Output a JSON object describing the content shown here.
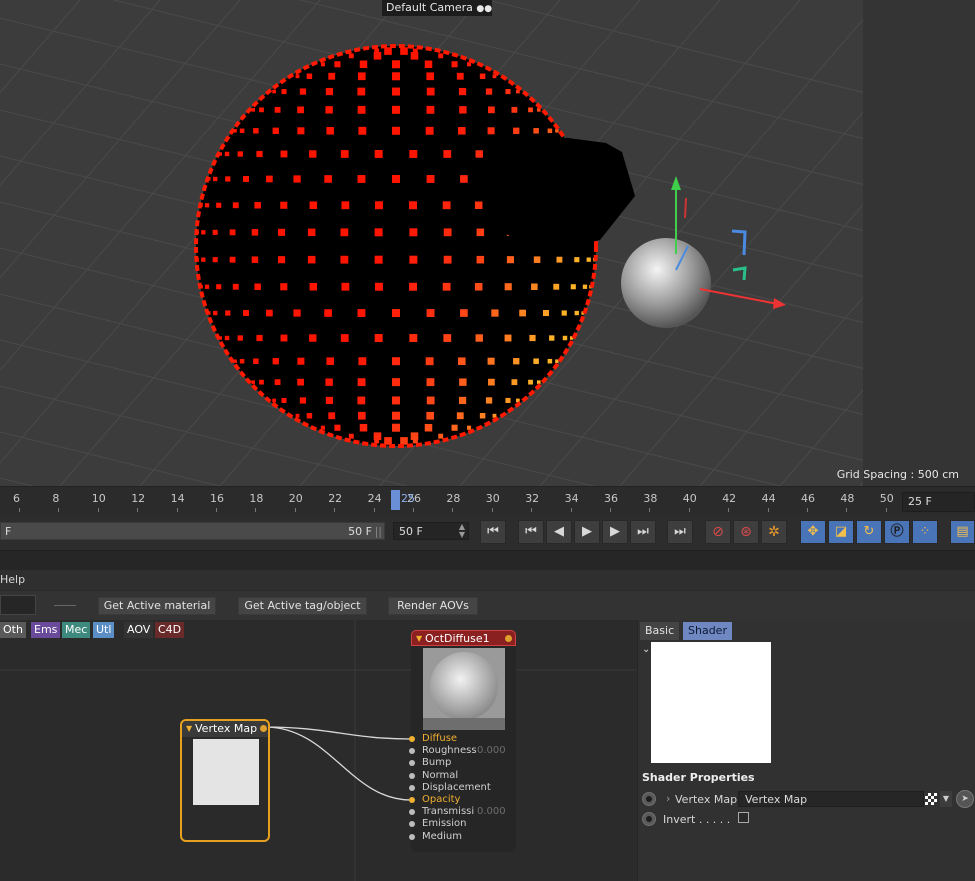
{
  "viewport": {
    "camera_label": "Default Camera",
    "grid_spacing": "Grid Spacing : 500 cm"
  },
  "timeline": {
    "ruler": [
      "6",
      "8",
      "10",
      "12",
      "14",
      "16",
      "18",
      "20",
      "22",
      "24",
      "26",
      "28",
      "30",
      "32",
      "34",
      "36",
      "38",
      "40",
      "42",
      "44",
      "46",
      "48",
      "50"
    ],
    "current_frame_marker": "25",
    "current_frame_field": "25 F"
  },
  "transport": {
    "range_start": "F",
    "range_end": "50 F",
    "end_field": "50 F",
    "buttons": [
      "go-to-start",
      "prev-key",
      "prev-frame",
      "play",
      "next-frame",
      "next-key",
      "go-to-end"
    ]
  },
  "node_editor": {
    "menu_help": "Help",
    "toolbar": {
      "get_active_material": "Get Active material",
      "get_active_tag": "Get Active tag/object",
      "render_aovs": "Render AOVs"
    },
    "categories": [
      {
        "label": "Oth",
        "color": "#5a5a5a"
      },
      {
        "label": "Ems",
        "color": "#6a4a9a"
      },
      {
        "label": "Mec",
        "color": "#3f8a7e"
      },
      {
        "label": "Utl",
        "color": "#5b8ec4"
      },
      {
        "label": "AOV",
        "color": "#333333"
      },
      {
        "label": "C4D",
        "color": "#6a2a2a"
      }
    ],
    "vertex_node": {
      "title": "Vertex Map"
    },
    "diffuse_node": {
      "title": "OctDiffuse1",
      "inputs": [
        {
          "name": "Diffuse",
          "value": "",
          "highlight": true
        },
        {
          "name": "Roughness",
          "value": "0.000",
          "highlight": false
        },
        {
          "name": "Bump",
          "value": "",
          "highlight": false
        },
        {
          "name": "Normal",
          "value": "",
          "highlight": false
        },
        {
          "name": "Displacement",
          "value": "",
          "highlight": false
        },
        {
          "name": "Opacity",
          "value": "",
          "highlight": true
        },
        {
          "name": "Transmissi",
          "value": "0.000",
          "highlight": false
        },
        {
          "name": "Emission",
          "value": "",
          "highlight": false
        },
        {
          "name": "Medium",
          "value": "",
          "highlight": false
        }
      ]
    }
  },
  "properties": {
    "tab_basic": "Basic",
    "tab_shader": "Shader",
    "section_title": "Shader Properties",
    "vertex_map_label": "Vertex Map",
    "vertex_map_value": "Vertex Map",
    "invert_label": "Invert . . . . ."
  },
  "colors": {
    "accent_blue": "#6f88c2",
    "node_orange": "#f0b030",
    "sphere_red": "#ff1a00"
  }
}
